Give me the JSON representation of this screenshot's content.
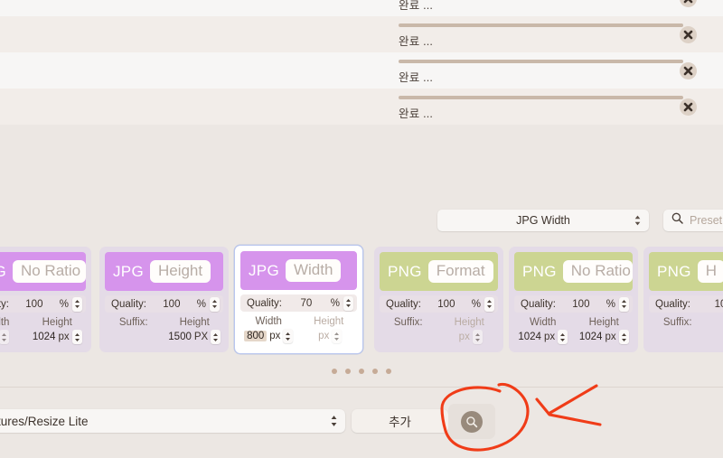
{
  "queue": {
    "status_label": "완료 ...",
    "remove_icon": "close-x-icon",
    "rows": [
      {
        "status": "완료 ...",
        "progress": 100
      },
      {
        "status": "완료 ...",
        "progress": 100
      },
      {
        "status": "완료 ...",
        "progress": 100
      },
      {
        "status": "완료 ...",
        "progress": 100
      },
      {
        "status": "완료 ...",
        "progress": 100
      }
    ]
  },
  "toolbar": {
    "preset_type_value": "JPG Width",
    "search_placeholder": "Preset",
    "search_icon": "search-icon",
    "stepper_icon": "up-down-chevron-icon"
  },
  "presets": {
    "cards": [
      {
        "format": "JPG",
        "name": "No Ratio",
        "quality_label": "Quality:",
        "quality_value": "100",
        "percent": "%",
        "left_label": "Width",
        "left_value": "",
        "left_unit": "px",
        "right_label": "Height",
        "right_value": "1024",
        "right_unit": "px",
        "selected": false
      },
      {
        "format": "JPG",
        "name": "Height",
        "quality_label": "Quality:",
        "quality_value": "100",
        "percent": "%",
        "left_label": "Suffix:",
        "left_value": "",
        "left_unit": "",
        "right_label": "Height",
        "right_value": "1500",
        "right_unit": "PX",
        "selected": false
      },
      {
        "format": "JPG",
        "name": "Width",
        "quality_label": "Quality:",
        "quality_value": "70",
        "percent": "%",
        "left_label": "Width",
        "left_value": "800",
        "left_unit": "px",
        "right_label": "Height",
        "right_value": "",
        "right_unit": "px",
        "selected": true
      },
      {
        "format": "PNG",
        "name": "Format",
        "quality_label": "Quality:",
        "quality_value": "100",
        "percent": "%",
        "left_label": "Suffix:",
        "left_value": "",
        "left_unit": "",
        "right_label": "Height",
        "right_value": "",
        "right_unit": "px",
        "selected": false
      },
      {
        "format": "PNG",
        "name": "No Ratio",
        "quality_label": "Quality:",
        "quality_value": "100",
        "percent": "%",
        "left_label": "Width",
        "left_value": "1024",
        "left_unit": "px",
        "right_label": "Height",
        "right_value": "1024",
        "right_unit": "px",
        "selected": false
      },
      {
        "format": "PNG",
        "name": "H",
        "quality_label": "Quality:",
        "quality_value": "10",
        "percent": "",
        "left_label": "Suffix:",
        "left_value": "",
        "left_unit": "",
        "right_label": "",
        "right_value": "",
        "right_unit": "",
        "selected": false
      }
    ],
    "page_dots": 5,
    "active_dot": -1
  },
  "bottom": {
    "output_path": "/Users/.../Pictures/Resize Lite",
    "output_path_visible": "g/Pictures/Resize Lite",
    "add_label": "추가",
    "search_icon": "search-icon"
  },
  "annotation": {
    "color": "#f03c18",
    "shapes": [
      "circle-around-search-button",
      "arrow-pointing-left"
    ]
  },
  "colors": {
    "jpg_header": "#d694ec",
    "png_header": "#ccd592",
    "panel_bg": "#ece7e3",
    "row_odd": "#f7f6f5",
    "row_even": "#f2ede9",
    "progress": "#c9b8a9",
    "selected_border": "#b9c6ef",
    "annotation_red": "#f03c18"
  }
}
